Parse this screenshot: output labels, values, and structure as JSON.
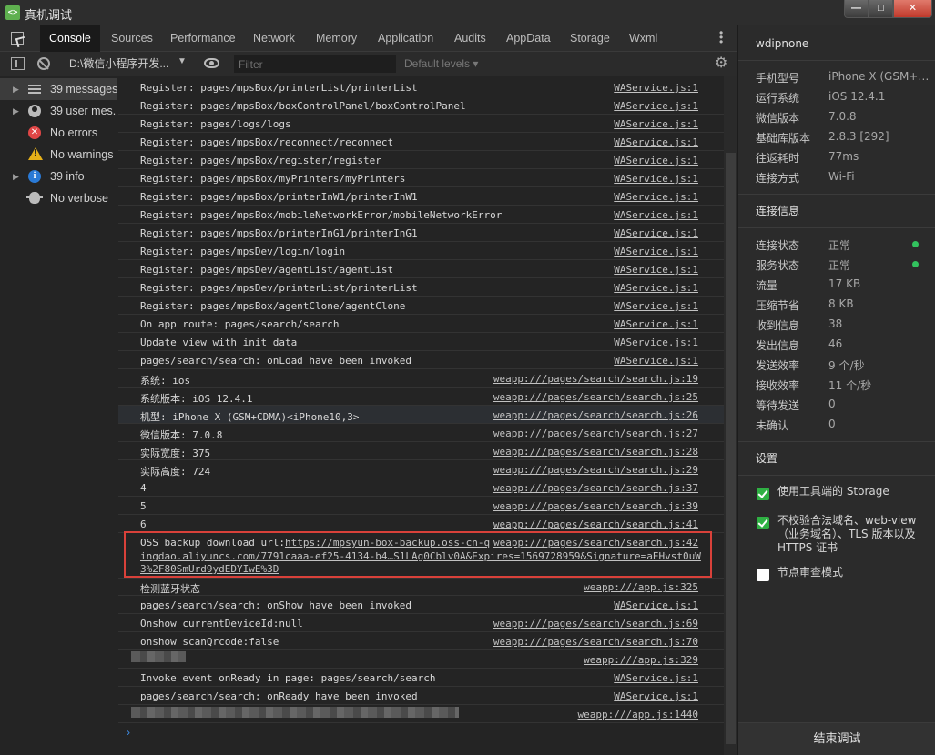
{
  "window": {
    "title": "真机调试",
    "icon_text": "<>"
  },
  "tabs": [
    "Console",
    "Sources",
    "Performance",
    "Network",
    "Memory",
    "Application",
    "Audits",
    "AppData",
    "Storage",
    "Wxml"
  ],
  "filterbar": {
    "context": "D:\\微信小程序开发...",
    "filter_placeholder": "Filter",
    "levels": "Default levels ▾"
  },
  "sidebar": {
    "items": [
      {
        "label": "39 messages",
        "icon": "list-icon"
      },
      {
        "label": "39 user mes...",
        "icon": "user-icon"
      },
      {
        "label": "No errors",
        "icon": "error-icon"
      },
      {
        "label": "No warnings",
        "icon": "warning-icon"
      },
      {
        "label": "39 info",
        "icon": "info-icon"
      },
      {
        "label": "No verbose",
        "icon": "bug-icon"
      }
    ]
  },
  "logs": [
    {
      "msg": "Register: pages/mpsBox/printerList/printerList",
      "src": "WAService.js:1"
    },
    {
      "msg": "Register: pages/mpsBox/boxControlPanel/boxControlPanel",
      "src": "WAService.js:1"
    },
    {
      "msg": "Register: pages/logs/logs",
      "src": "WAService.js:1"
    },
    {
      "msg": "Register: pages/mpsBox/reconnect/reconnect",
      "src": "WAService.js:1"
    },
    {
      "msg": "Register: pages/mpsBox/register/register",
      "src": "WAService.js:1"
    },
    {
      "msg": "Register: pages/mpsBox/myPrinters/myPrinters",
      "src": "WAService.js:1"
    },
    {
      "msg": "Register: pages/mpsBox/printerInW1/printerInW1",
      "src": "WAService.js:1"
    },
    {
      "msg": "Register: pages/mpsBox/mobileNetworkError/mobileNetworkError",
      "src": "WAService.js:1"
    },
    {
      "msg": "Register: pages/mpsBox/printerInG1/printerInG1",
      "src": "WAService.js:1"
    },
    {
      "msg": "Register: pages/mpsDev/login/login",
      "src": "WAService.js:1"
    },
    {
      "msg": "Register: pages/mpsDev/agentList/agentList",
      "src": "WAService.js:1"
    },
    {
      "msg": "Register: pages/mpsDev/printerList/printerList",
      "src": "WAService.js:1"
    },
    {
      "msg": "Register: pages/mpsBox/agentClone/agentClone",
      "src": "WAService.js:1"
    },
    {
      "msg": "On app route: pages/search/search",
      "src": "WAService.js:1"
    },
    {
      "msg": "Update view with init data",
      "src": "WAService.js:1"
    },
    {
      "msg": "pages/search/search: onLoad have been invoked",
      "src": "WAService.js:1"
    },
    {
      "msg": "系统: ios",
      "src": "weapp:///pages/search/search.js:19"
    },
    {
      "msg": "系统版本: iOS 12.4.1",
      "src": "weapp:///pages/search/search.js:25"
    },
    {
      "msg": "机型: iPhone X (GSM+CDMA)<iPhone10,3>",
      "src": "weapp:///pages/search/search.js:26"
    },
    {
      "msg": "微信版本: 7.0.8",
      "src": "weapp:///pages/search/search.js:27"
    },
    {
      "msg": "实际宽度: 375",
      "src": "weapp:///pages/search/search.js:28"
    },
    {
      "msg": "实际高度: 724",
      "src": "weapp:///pages/search/search.js:29"
    },
    {
      "msg": "4",
      "src": "weapp:///pages/search/search.js:37"
    },
    {
      "msg": "5",
      "src": "weapp:///pages/search/search.js:39"
    },
    {
      "msg": "6",
      "src": "weapp:///pages/search/search.js:41"
    }
  ],
  "oss": {
    "prefix": "OSS backup download url:",
    "link1": "https://mpsyun-box-backup.oss-cn-q",
    "src": "weapp:///pages/search/search.js:42",
    "link2": "ingdao.aliyuncs.com/7791caaa-ef25-4134-b4…S1LAg0Cblv0A&Expires=1569728959&Signature=aEHvst0uW",
    "link3": "3%2F80SmUrd9ydEDYIwE%3D"
  },
  "logs2": [
    {
      "msg": "检测蓝牙状态",
      "src": "weapp:///app.js:325"
    },
    {
      "msg": "pages/search/search: onShow have been invoked",
      "src": "WAService.js:1"
    },
    {
      "msg": "Onshow currentDeviceId:null",
      "src": "weapp:///pages/search/search.js:69"
    },
    {
      "msg": "onshow scanQrcode:false",
      "src": "weapp:///pages/search/search.js:70"
    },
    {
      "msg": "",
      "src": "weapp:///app.js:329"
    },
    {
      "msg": "Invoke event onReady in page: pages/search/search",
      "src": "WAService.js:1"
    },
    {
      "msg": "pages/search/search: onReady have been invoked",
      "src": "WAService.js:1"
    },
    {
      "msg": "",
      "src": "weapp:///app.js:1440"
    }
  ],
  "prompt": "›",
  "device": {
    "name": "wdipnone",
    "info": [
      {
        "k": "手机型号",
        "v": "iPhone X (GSM+…"
      },
      {
        "k": "运行系统",
        "v": "iOS 12.4.1"
      },
      {
        "k": "微信版本",
        "v": "7.0.8"
      },
      {
        "k": "基础库版本",
        "v": "2.8.3 [292]"
      },
      {
        "k": "往返耗时",
        "v": "77ms"
      },
      {
        "k": "连接方式",
        "v": "Wi-Fi"
      }
    ],
    "conn_title": "连接信息",
    "conn": [
      {
        "k": "连接状态",
        "v": "正常",
        "dot": true
      },
      {
        "k": "服务状态",
        "v": "正常",
        "dot": true
      },
      {
        "k": "流量",
        "v": "17 KB"
      },
      {
        "k": "压缩节省",
        "v": "8 KB"
      },
      {
        "k": "收到信息",
        "v": "38"
      },
      {
        "k": "发出信息",
        "v": "46"
      },
      {
        "k": "发送效率",
        "v": "9 个/秒"
      },
      {
        "k": "接收效率",
        "v": "11 个/秒"
      },
      {
        "k": "等待发送",
        "v": "0"
      },
      {
        "k": "未确认",
        "v": "0"
      }
    ],
    "settings_title": "设置",
    "settings": [
      {
        "label": "使用工具端的 Storage",
        "checked": true
      },
      {
        "label": "不校验合法域名、web-view（业务域名）、TLS 版本以及 HTTPS 证书",
        "checked": true
      },
      {
        "label": "节点审查模式",
        "checked": false
      }
    ],
    "end_button": "结束调试"
  },
  "colors": {
    "accent_green": "#2fb043",
    "status_dot": "#32c25e",
    "highlight_border": "#d9413a"
  }
}
